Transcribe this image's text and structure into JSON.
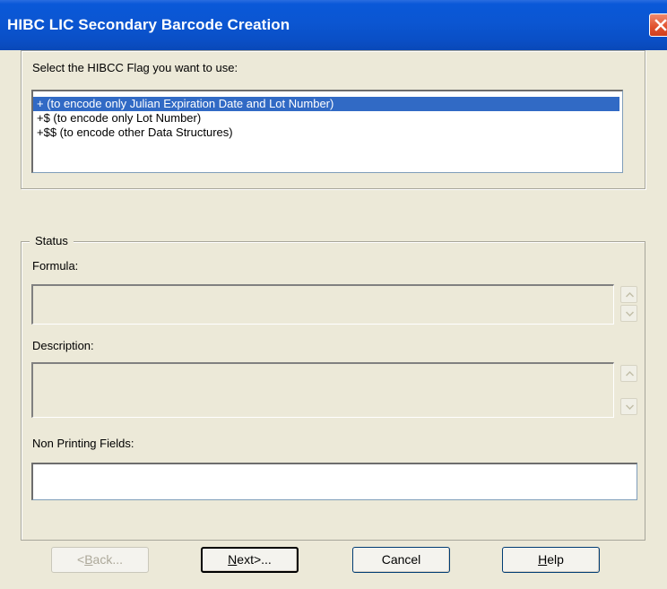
{
  "window": {
    "title": "HIBC LIC Secondary Barcode Creation",
    "close_icon": "close-icon"
  },
  "flag_section": {
    "label": "Select the HIBCC Flag you want to use:",
    "options": [
      "+ (to encode only Julian Expiration Date and Lot Number)",
      "+$ (to encode only Lot Number)",
      "+$$ (to encode other Data Structures)"
    ],
    "selected_index": 0
  },
  "status": {
    "legend": "Status",
    "formula_label": "Formula:",
    "formula_value": "",
    "description_label": "Description:",
    "description_value": "",
    "non_printing_label": "Non Printing Fields:",
    "non_printing_value": ""
  },
  "buttons": {
    "back": {
      "before": "<",
      "mnemonic": "B",
      "after": "ack..."
    },
    "next": {
      "before": "",
      "mnemonic": "N",
      "after": "ext>..."
    },
    "cancel": "Cancel",
    "help": {
      "before": "",
      "mnemonic": "H",
      "after": "elp"
    }
  },
  "colors": {
    "titlebar": "#0a58d8",
    "selection": "#316ac5",
    "dialog_bg": "#ece9d8",
    "close_button": "#e0502c"
  }
}
